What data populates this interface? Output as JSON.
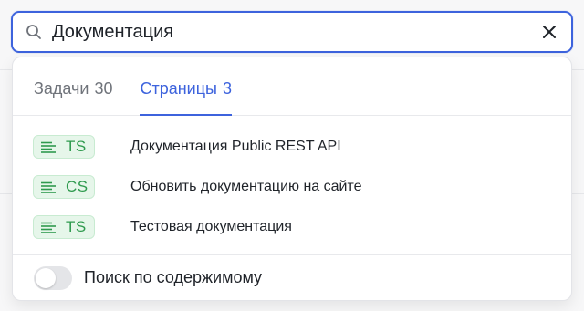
{
  "search": {
    "value": "Документация",
    "icon": "search-icon",
    "clear_icon": "close-icon",
    "accent": "#3d63dd"
  },
  "tabs": [
    {
      "label": "Задачи",
      "count": "30",
      "active": false
    },
    {
      "label": "Страницы",
      "count": "3",
      "active": true
    }
  ],
  "results": [
    {
      "code": "TS",
      "title": "Документация Public REST API",
      "icon": "document-lines-icon"
    },
    {
      "code": "CS",
      "title": "Обновить документацию на сайте",
      "icon": "document-lines-icon"
    },
    {
      "code": "TS",
      "title": "Тестовая документация",
      "icon": "document-lines-icon"
    }
  ],
  "badge_color": "#2f9a4e",
  "footer": {
    "toggle_label": "Поиск по содержимому",
    "toggle_on": false
  }
}
